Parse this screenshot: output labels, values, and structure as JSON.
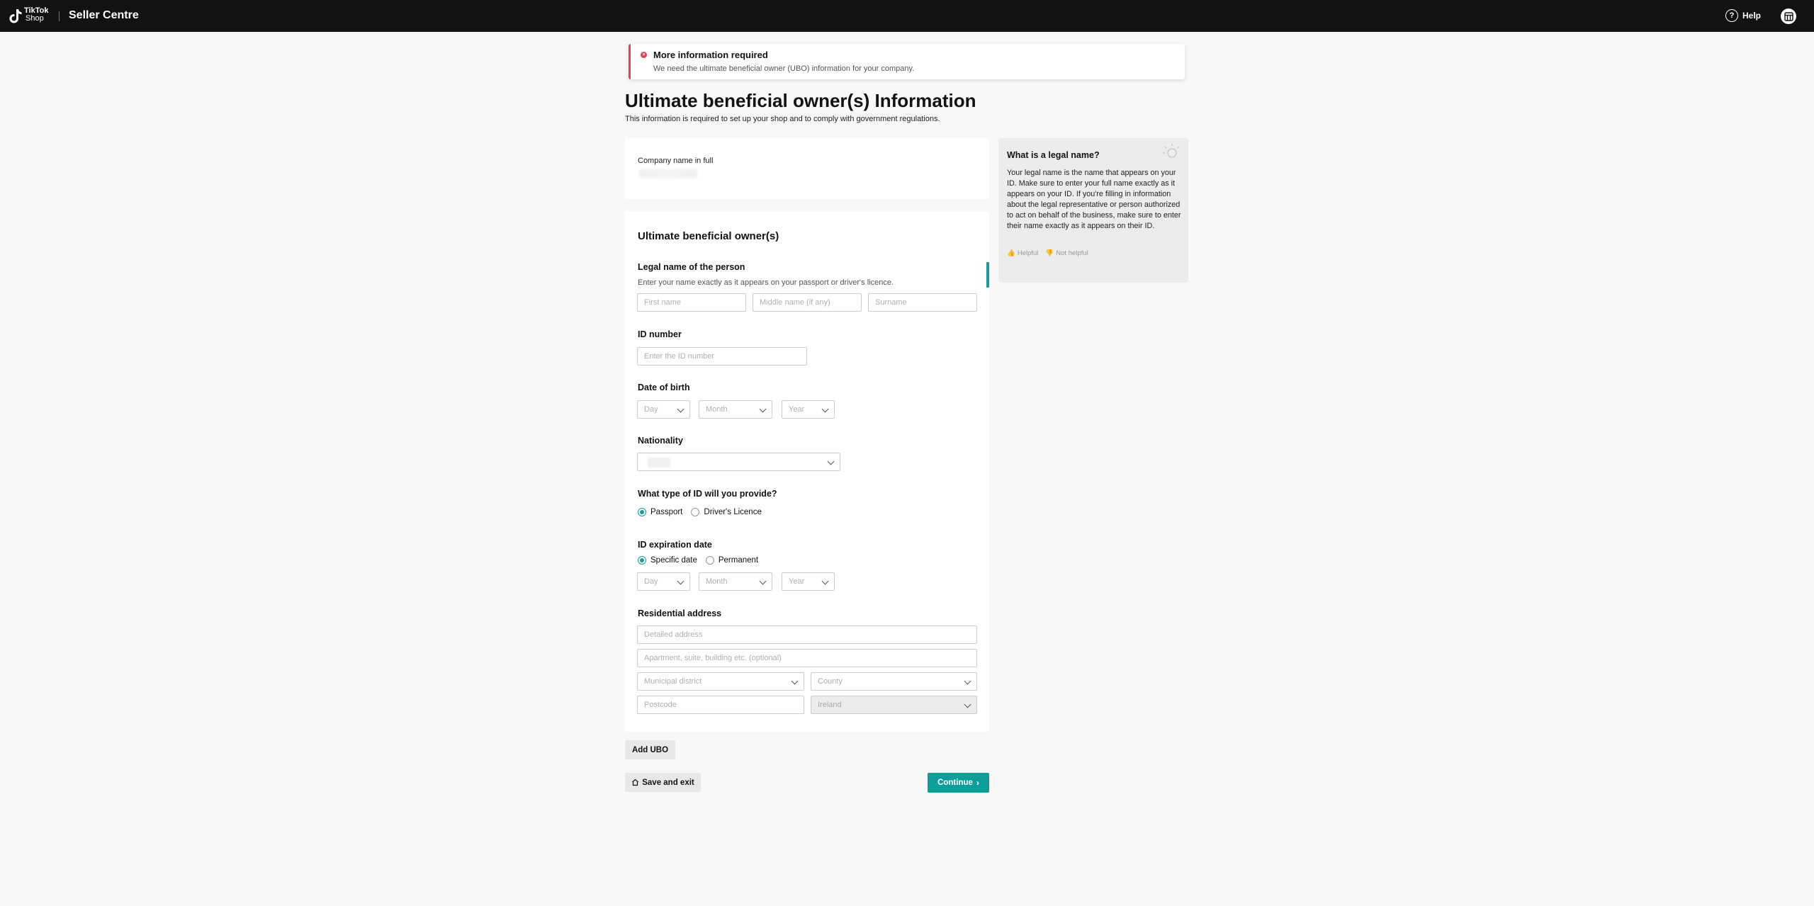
{
  "header": {
    "logo_line1": "TikTok",
    "logo_line2": "Shop",
    "brand": "Seller Centre",
    "help_label": "Help"
  },
  "alert": {
    "title": "More information required",
    "description": "We need the ultimate beneficial owner (UBO) information for your company.",
    "color": "#e04455"
  },
  "page": {
    "title": "Ultimate beneficial owner(s) Information",
    "subtitle": "This information is required to set up your shop and to comply with government regulations."
  },
  "company": {
    "label": "Company name in full"
  },
  "ubo": {
    "section_title": "Ultimate beneficial owner(s)",
    "legal_name": {
      "label": "Legal name of the person",
      "hint": "Enter your name exactly as it appears on your passport or driver's licence.",
      "first_placeholder": "First name",
      "middle_placeholder": "Middle name (if any)",
      "surname_placeholder": "Surname"
    },
    "id_number": {
      "label": "ID number",
      "placeholder": "Enter the ID number"
    },
    "dob": {
      "label": "Date of birth",
      "day": "Day",
      "month": "Month",
      "year": "Year"
    },
    "nationality": {
      "label": "Nationality"
    },
    "id_type": {
      "label": "What type of ID will you provide?",
      "options": [
        "Passport",
        "Driver's Licence"
      ],
      "selected": "Passport"
    },
    "id_expiry": {
      "label": "ID expiration date",
      "options": [
        "Specific date",
        "Permanent"
      ],
      "selected": "Specific date",
      "day": "Day",
      "month": "Month",
      "year": "Year"
    },
    "address": {
      "label": "Residential address",
      "detailed_placeholder": "Detailed address",
      "apartment_placeholder": "Apartment, suite, building etc. (optional)",
      "district_placeholder": "Municipal district",
      "county_placeholder": "County",
      "postcode_placeholder": "Postcode",
      "country_value": "Ireland"
    }
  },
  "actions": {
    "add_ubo": "Add UBO",
    "save_exit": "Save and exit",
    "continue": "Continue"
  },
  "help_panel": {
    "title": "What is a legal name?",
    "body": "Your legal name is the name that appears on your ID. Make sure to enter your full name exactly as it appears on your ID. If you're filling in information about the legal representative or person authorized to act on behalf of the business, make sure to enter their name exactly as it appears on their ID.",
    "helpful": "Helpful",
    "not_helpful": "Not helpful"
  },
  "colors": {
    "accent": "#0e9e9a",
    "header_bg": "#121212",
    "error": "#e04455"
  }
}
